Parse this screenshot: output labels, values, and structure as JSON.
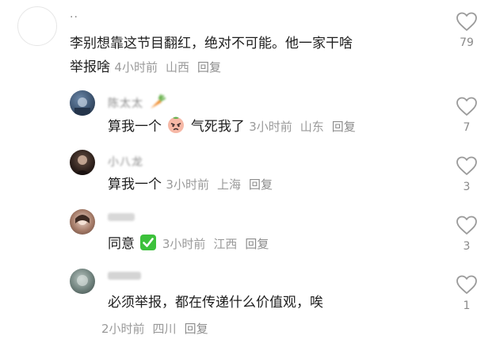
{
  "main_comment": {
    "username": "..",
    "text_line1": "李别想靠这节目翻红，绝对不可能。他一家干啥",
    "text_line2": "举报啥",
    "time": "4小时前",
    "location": "山西",
    "reply_label": "回复",
    "likes": "79"
  },
  "replies": [
    {
      "username": "陈太太",
      "text_before": "算我一个",
      "text_after": "气死我了",
      "time": "3小时前",
      "location": "山东",
      "reply_label": "回复",
      "likes": "7"
    },
    {
      "username": "小八龙",
      "text": "算我一个",
      "time": "3小时前",
      "location": "上海",
      "reply_label": "回复",
      "likes": "3"
    },
    {
      "username": "",
      "text": "同意",
      "time": "3小时前",
      "location": "江西",
      "reply_label": "回复",
      "likes": "3"
    },
    {
      "username": "",
      "text": "必须举报，都在传递什么价值观，唉",
      "time": "2小时前",
      "location": "四川",
      "reply_label": "回复",
      "likes": "1"
    }
  ],
  "colors": {
    "text": "#1e1e1e",
    "meta": "#9a9a9a",
    "heart_outline": "#9b9b9b",
    "check_emoji": "#3cc13b"
  },
  "icons": {
    "like": "heart-outline-icon",
    "carrot": "carrot-icon",
    "peach_face": "angry-face-emoji",
    "check": "check-mark-emoji"
  }
}
